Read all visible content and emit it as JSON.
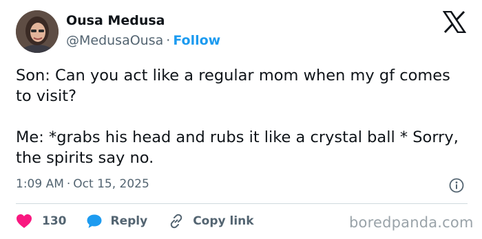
{
  "author": {
    "name": "Ousa Medusa",
    "handle": "@MedusaOusa",
    "separator": "·",
    "follow_label": "Follow"
  },
  "tweet": {
    "lines": [
      "Son: Can you act like a regular mom when my gf comes to visit?",
      "Me: *grabs his head and rubs it like a crystal ball * Sorry, the spirits say no."
    ],
    "time": "1:09 AM",
    "separator": "·",
    "date": "Oct 15, 2025"
  },
  "actions": {
    "like_count": "130",
    "reply_label": "Reply",
    "copy_link_label": "Copy link"
  },
  "icons": {
    "logo": "x-logo-icon",
    "info": "info-icon",
    "like": "heart-icon",
    "reply": "speech-bubble-icon",
    "copy": "link-icon"
  },
  "colors": {
    "accent": "#1d9bf0",
    "heart": "#f91880",
    "text": "#0f1419",
    "muted": "#536471",
    "divider": "#cfd9de",
    "watermark": "#9aa3a9"
  },
  "watermark": "boredpanda.com"
}
